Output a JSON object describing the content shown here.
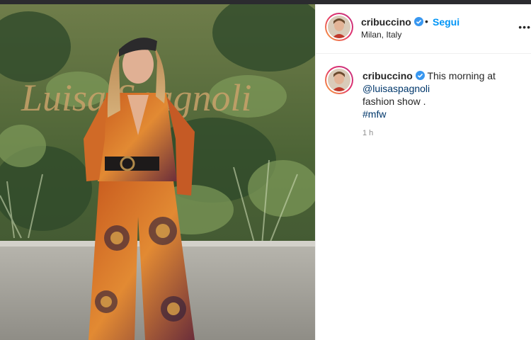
{
  "post": {
    "photo_signage": "Luisa Spagnoli"
  },
  "header": {
    "username": "cribuccino",
    "verified": true,
    "separator": "•",
    "follow_label": "Segui",
    "location": "Milan, Italy",
    "more_icon": "ellipsis-icon"
  },
  "caption": {
    "username": "cribuccino",
    "line1": "This morning at",
    "mention": "@luisaspagnoli",
    "line3": "fashion show .",
    "hashtag": "#mfw",
    "time": "1 h"
  },
  "colors": {
    "link_blue": "#0095f6",
    "mention_blue": "#00376b",
    "verified_blue": "#3897f0",
    "muted": "#8e8e8e",
    "topbar": "#2b2b2f"
  }
}
